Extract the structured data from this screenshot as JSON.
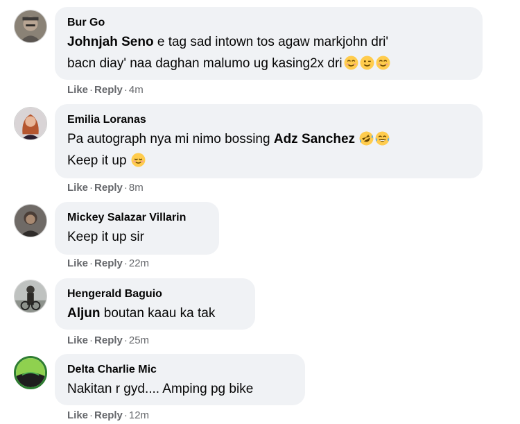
{
  "comments": [
    {
      "author": "Bur Go",
      "mention": "Johnjah Seno",
      "line1": " e tag sad intown tos agaw markjohn dri'",
      "line2": "bacn diay' naa daghan malumo ug kasing2x dri",
      "emojis": [
        "smiling-eyes",
        "wink",
        "smiling-eyes"
      ],
      "like": "Like",
      "reply": "Reply",
      "time": "4m"
    },
    {
      "author": "Emilia Loranas",
      "line1": "Pa autograph nya mi nimo bossing ",
      "mention": "Adz Sanchez",
      "emojis": [
        "rofl",
        "joy"
      ],
      "line2": "Keep it up",
      "line2_emoji": "relieved",
      "like": "Like",
      "reply": "Reply",
      "time": "8m"
    },
    {
      "author": "Mickey Salazar Villarin",
      "text": "Keep it up sir",
      "like": "Like",
      "reply": "Reply",
      "time": "22m"
    },
    {
      "author": "Hengerald Baguio",
      "mention": "Aljun",
      "text": " boutan kaau ka tak",
      "like": "Like",
      "reply": "Reply",
      "time": "25m"
    },
    {
      "author": "Delta Charlie Mic",
      "text": "Nakitan r gyd.... Amping pg bike",
      "like": "Like",
      "reply": "Reply",
      "time": "12m"
    }
  ],
  "separator": "·",
  "colors": {
    "bubble": "#f0f2f5",
    "action_text": "#65676b",
    "emoji_face": "#ffcc4d",
    "avatar_ring": "#2e7d32"
  }
}
